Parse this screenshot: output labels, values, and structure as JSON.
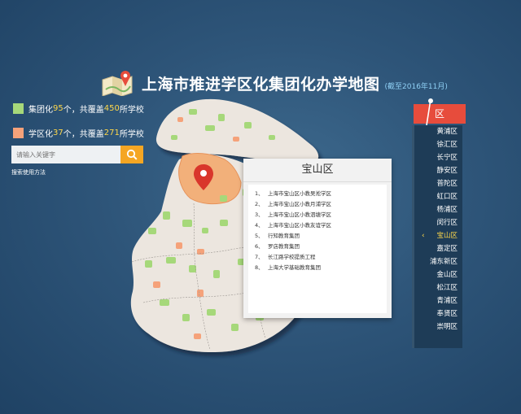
{
  "header": {
    "title": "上海市推进学区化集团化办学地图",
    "date": "(截至2016年11月)"
  },
  "legend": [
    {
      "label_a": "集团化",
      "count": "95",
      "label_b": "个，共覆盖",
      "schools": "450",
      "label_c": "所学校",
      "color": "#a6d87a"
    },
    {
      "label_a": "学区化",
      "count": "37",
      "label_b": "个，共覆盖",
      "schools": "271",
      "label_c": "所学校",
      "color": "#f5a27a"
    }
  ],
  "search": {
    "placeholder": "请输入关键字",
    "help": "搜索使用方法"
  },
  "popup": {
    "title": "宝山区",
    "items": [
      {
        "idx": "1、",
        "text": "上海市宝山区小教吴淞学区"
      },
      {
        "idx": "2、",
        "text": "上海市宝山区小教月浦学区"
      },
      {
        "idx": "3、",
        "text": "上海市宝山区小教泗塘学区"
      },
      {
        "idx": "4、",
        "text": "上海市宝山区小教友谊学区"
      },
      {
        "idx": "5、",
        "text": "行知教育集团"
      },
      {
        "idx": "6、",
        "text": "罗店教育集团"
      },
      {
        "idx": "7、",
        "text": "长江路学校提质工程"
      },
      {
        "idx": "8、",
        "text": "上海大学基础教育集团"
      }
    ]
  },
  "districts": {
    "header": "区",
    "items": [
      "黄浦区",
      "徐汇区",
      "长宁区",
      "静安区",
      "普陀区",
      "虹口区",
      "杨浦区",
      "闵行区",
      "宝山区",
      "嘉定区",
      "浦东新区",
      "金山区",
      "松江区",
      "青浦区",
      "奉贤区",
      "崇明区"
    ],
    "active": "宝山区"
  },
  "colors": {
    "accent": "#e74c3c",
    "highlight": "#ffd84a",
    "group": "#a6d87a",
    "district": "#f5a27a"
  }
}
